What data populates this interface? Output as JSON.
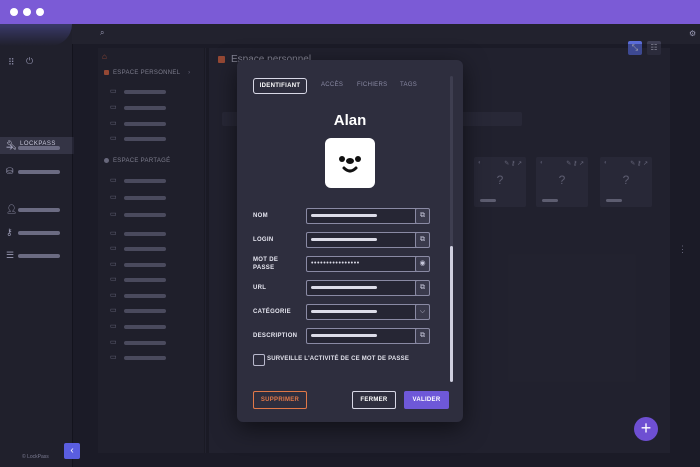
{
  "rail": {
    "active_label": "LOCKPASS",
    "footer": "© LockPass"
  },
  "tree": {
    "personal_header": "ESPACE PERSONNEL",
    "shared_header": "ESPACE PARTAGÉ",
    "expand_arrow": "›"
  },
  "content": {
    "title": "Espace personnel",
    "card_placeholder": "?"
  },
  "modal": {
    "tabs": [
      "IDENTIFIANT",
      "ACCÈS",
      "FICHIERS",
      "TAGS"
    ],
    "entry_name": "Alan",
    "fields": {
      "nom": "NOM",
      "login": "LOGIN",
      "mot_de_passe_1": "MOT DE",
      "mot_de_passe_2": "PASSE",
      "url": "URL",
      "categorie": "CATÉGORIE",
      "description": "DESCRIPTION"
    },
    "password_mask": "••••••••••••••••",
    "monitor_label": "SURVEILLE L'ACTIVITÉ DE CE MOT DE PASSE",
    "buttons": {
      "delete": "SUPPRIMER",
      "close": "FERMER",
      "validate": "VALIDER"
    }
  },
  "icons": {
    "copy": "⧉",
    "eye": "◉",
    "chevron_down": "⌵",
    "plus": "+",
    "back": "‹"
  },
  "colors": {
    "accent": "#6e58d8",
    "titlebar": "#7b5bd6",
    "danger": "#e07848"
  }
}
